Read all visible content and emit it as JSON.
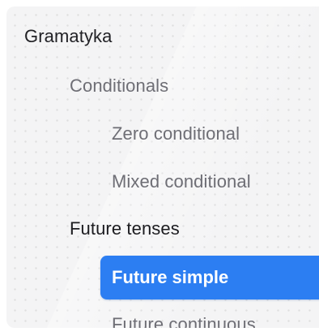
{
  "tree": {
    "root_label": "Gramatyka",
    "items": [
      {
        "label": "Conditionals"
      },
      {
        "label": "Zero conditional"
      },
      {
        "label": "Mixed conditional"
      },
      {
        "label": "Future tenses"
      },
      {
        "label": "Future simple"
      },
      {
        "label": "Future continuous"
      }
    ],
    "selected_label": "Future simple"
  },
  "colors": {
    "accent": "#2c7ef2",
    "panel_bg": "#f4f4f5",
    "muted_text": "#6e6e75",
    "strong_text": "#1c1c20"
  }
}
